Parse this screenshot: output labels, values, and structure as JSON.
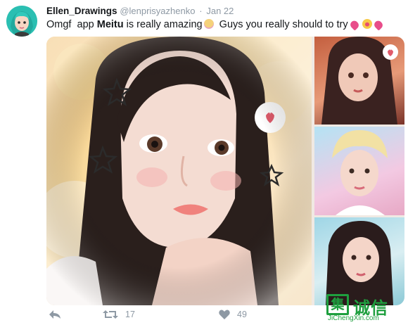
{
  "tweet": {
    "display_name": "Ellen_Drawings",
    "handle": "@lenprisyazhenko",
    "separator": "·",
    "date": "Jan 22",
    "text_before": "Omgf  app ",
    "text_bold": "Meitu",
    "text_after": " is really amazing",
    "text_after_emoji": "  Guys you really should to try",
    "emoji": [
      "heart-eyes-emoji",
      "two-hearts-emoji",
      "angel-emoji",
      "two-hearts-emoji"
    ]
  },
  "media": {
    "main_photo_icon": "portrait-photo",
    "thumbnails": [
      "portrait-thumbnail-1",
      "portrait-thumbnail-2",
      "portrait-thumbnail-3"
    ]
  },
  "actions": {
    "reply_icon": "reply-icon",
    "retweet_icon": "retweet-icon",
    "retweet_count": "17",
    "like_icon": "heart-icon",
    "like_count": "49"
  },
  "watermark": {
    "logo_char": "集",
    "chars": "诚信",
    "url": "JiChengXin.com"
  },
  "colors": {
    "name": "#14171a",
    "meta": "#8e99a4",
    "watermark": "#1e9f3e"
  }
}
